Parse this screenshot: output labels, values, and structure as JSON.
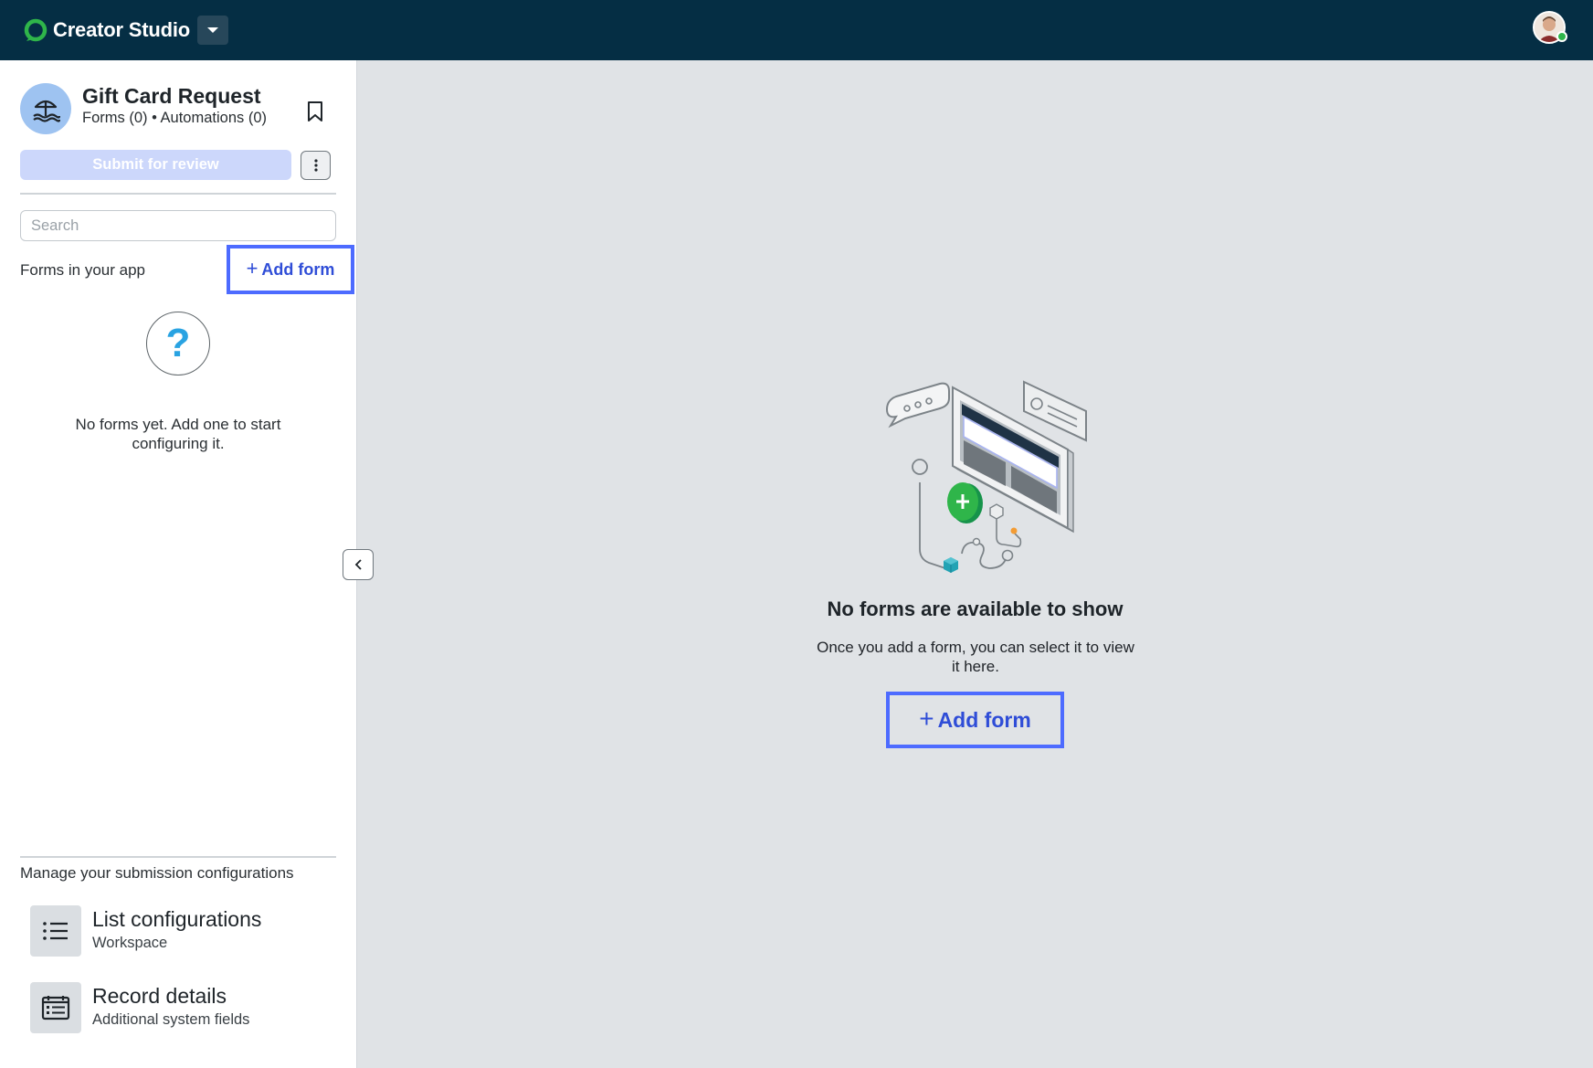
{
  "topbar": {
    "brand_name": "Creator Studio",
    "brand_color": "#2fb54a",
    "background": "#052e44",
    "user_status_color": "#2fb54a"
  },
  "sidebar": {
    "app_title": "Gift Card Request",
    "app_meta": "Forms (0) • Automations (0)",
    "submit_label": "Submit for review",
    "search_placeholder": "Search",
    "forms_label": "Forms in your app",
    "add_form_label": "Add form",
    "empty_text": "No forms yet. Add one to start configuring it.",
    "question_mark": "?",
    "manage_label": "Manage your submission configurations",
    "configs": [
      {
        "title": "List configurations",
        "subtitle": "Workspace",
        "icon": "list-icon"
      },
      {
        "title": "Record details",
        "subtitle": "Additional system fields",
        "icon": "record-details-icon"
      }
    ]
  },
  "main": {
    "empty_title": "No forms are available to show",
    "empty_desc": "Once you add a form, you can select it to view it here.",
    "add_form_label": "Add form"
  },
  "colors": {
    "accent": "#4d6bff",
    "accent_text": "#2f4dd7",
    "submit_disabled": "#ccd7fb",
    "main_bg": "#e0e3e6"
  }
}
